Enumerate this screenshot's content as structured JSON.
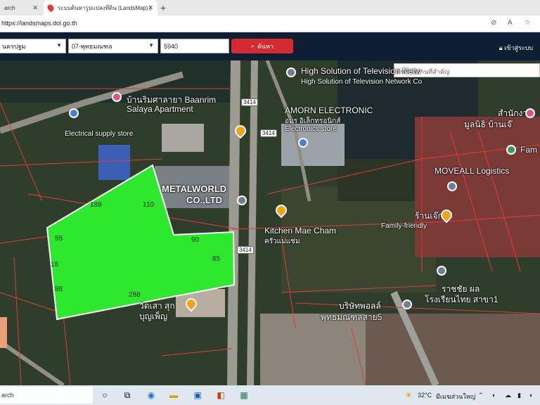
{
  "browser": {
    "tabs": [
      {
        "label": "arch"
      },
      {
        "label": "ระบบค้นหารูปแปลงที่ดิน (LandsMap) |"
      }
    ],
    "url": "https://landsmaps.dol.go.th"
  },
  "toolbar": {
    "province": "นครปฐม",
    "district": "07-พุทธมณฑล",
    "parcel_no": "5940",
    "search_label": "ค้นหา",
    "login_label": "เข้าสู่ระบบ"
  },
  "map": {
    "search_placeholder": "ค้นหาสถานที่สำคัญ",
    "places": {
      "tv_network": "High Solution of Television Network Co",
      "tv_network_th": "High Solution of Television Netw",
      "baanrim": "บ้านริมศาลายา Baanrim",
      "salaya": "Salaya Apartment",
      "electrical": "Electrical supply store",
      "amorn": "AMORN ELECTRONIC",
      "amorn_th": "อมร อิเล็กทรอนิกส์",
      "electronics_store": "Electronics store",
      "metalworld": "METALWORLD",
      "metalworld_co": "CO.,LTD",
      "kitchen": "Kitchen Mae Cham",
      "kitchen_th": "ครัวแม่แช่ม",
      "moveall": "MOVEALL Logistics",
      "ranjek": "ร้านเจ๊ก",
      "family": "Family-friendly",
      "samnakngan": "สำนักงาน",
      "mooban": "มูลนิธิ บ้านเจ๊",
      "fam": "Fam",
      "thai_bakery": "โรงเรียนไทย สาขา1",
      "rathchai": "ราชชัย ผล",
      "phutta_school": "พุทธมณฑลสาย5",
      "borisat": "บริษัทพอลล์",
      "boonpo": "บุญเพ็ญ",
      "wat": "วัดเสา สุก"
    },
    "road_shields": [
      "3414",
      "3414",
      "3414"
    ],
    "parcel_dims": [
      "188",
      "110",
      "55",
      "18",
      "88",
      "288",
      "90",
      "85"
    ],
    "parcel_color": "#2ee82e"
  },
  "taskbar": {
    "search": "arch",
    "weather": "32°C",
    "weather_desc": "มีเมฆส่วนใหญ่"
  }
}
